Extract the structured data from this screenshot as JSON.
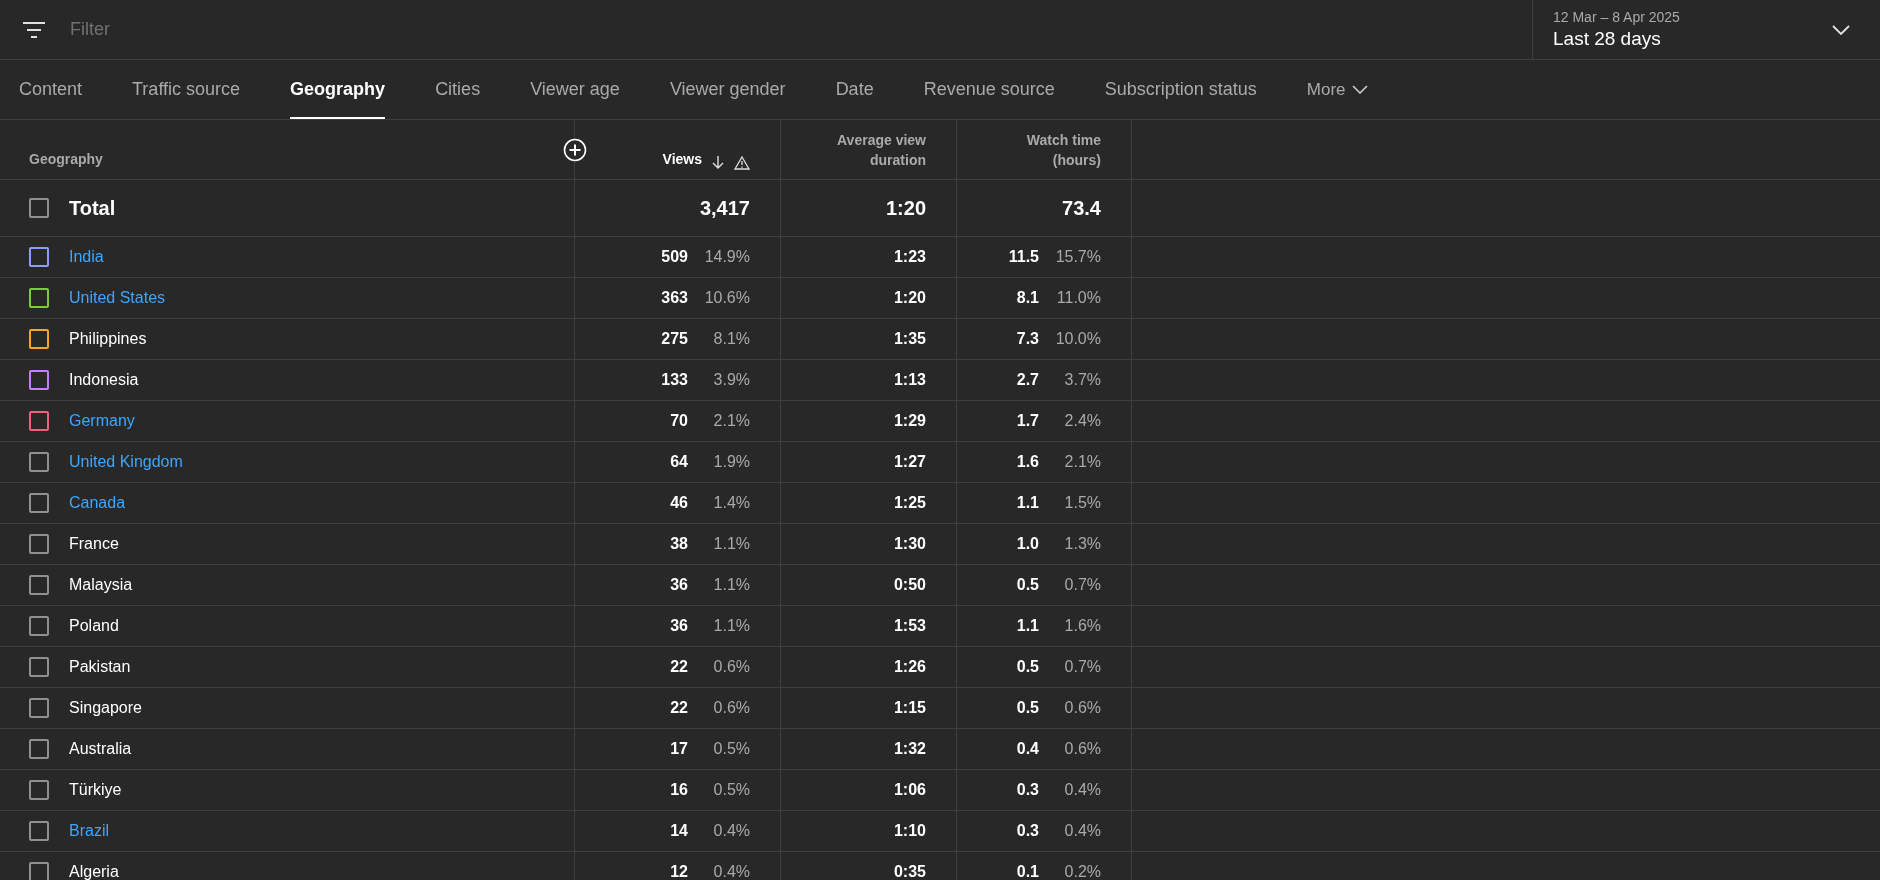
{
  "filter": {
    "placeholder": "Filter"
  },
  "date_range": {
    "range": "12 Mar – 8 Apr 2025",
    "label": "Last 28 days"
  },
  "tabs": [
    {
      "label": "Content",
      "selected": false
    },
    {
      "label": "Traffic source",
      "selected": false
    },
    {
      "label": "Geography",
      "selected": true
    },
    {
      "label": "Cities",
      "selected": false
    },
    {
      "label": "Viewer age",
      "selected": false
    },
    {
      "label": "Viewer gender",
      "selected": false
    },
    {
      "label": "Date",
      "selected": false
    },
    {
      "label": "Revenue source",
      "selected": false
    },
    {
      "label": "Subscription status",
      "selected": false
    }
  ],
  "more": {
    "label": "More"
  },
  "table": {
    "columns": [
      "Geography",
      "Views",
      "Average view duration",
      "Watch time (hours)"
    ],
    "total": {
      "label": "Total",
      "checked": false,
      "views": "3,417",
      "avg": "1:20",
      "watch": "73.4"
    },
    "rows": [
      {
        "name": "India",
        "link": true,
        "checked": false,
        "color": "#8d9cff",
        "views": "509",
        "views_pct": "14.9%",
        "avg": "1:23",
        "watch": "11.5",
        "watch_pct": "15.7%"
      },
      {
        "name": "United States",
        "link": true,
        "checked": false,
        "color": "#7ccb3a",
        "views": "363",
        "views_pct": "10.6%",
        "avg": "1:20",
        "watch": "8.1",
        "watch_pct": "11.0%"
      },
      {
        "name": "Philippines",
        "link": false,
        "checked": false,
        "color": "#f5a623",
        "views": "275",
        "views_pct": "8.1%",
        "avg": "1:35",
        "watch": "7.3",
        "watch_pct": "10.0%"
      },
      {
        "name": "Indonesia",
        "link": false,
        "checked": false,
        "color": "#c77dff",
        "views": "133",
        "views_pct": "3.9%",
        "avg": "1:13",
        "watch": "2.7",
        "watch_pct": "3.7%"
      },
      {
        "name": "Germany",
        "link": true,
        "checked": false,
        "color": "#f0607a",
        "views": "70",
        "views_pct": "2.1%",
        "avg": "1:29",
        "watch": "1.7",
        "watch_pct": "2.4%"
      },
      {
        "name": "United Kingdom",
        "link": true,
        "checked": false,
        "views": "64",
        "views_pct": "1.9%",
        "avg": "1:27",
        "watch": "1.6",
        "watch_pct": "2.1%"
      },
      {
        "name": "Canada",
        "link": true,
        "checked": false,
        "views": "46",
        "views_pct": "1.4%",
        "avg": "1:25",
        "watch": "1.1",
        "watch_pct": "1.5%"
      },
      {
        "name": "France",
        "link": false,
        "checked": false,
        "views": "38",
        "views_pct": "1.1%",
        "avg": "1:30",
        "watch": "1.0",
        "watch_pct": "1.3%"
      },
      {
        "name": "Malaysia",
        "link": false,
        "checked": false,
        "views": "36",
        "views_pct": "1.1%",
        "avg": "0:50",
        "watch": "0.5",
        "watch_pct": "0.7%"
      },
      {
        "name": "Poland",
        "link": false,
        "checked": false,
        "views": "36",
        "views_pct": "1.1%",
        "avg": "1:53",
        "watch": "1.1",
        "watch_pct": "1.6%"
      },
      {
        "name": "Pakistan",
        "link": false,
        "checked": false,
        "views": "22",
        "views_pct": "0.6%",
        "avg": "1:26",
        "watch": "0.5",
        "watch_pct": "0.7%"
      },
      {
        "name": "Singapore",
        "link": false,
        "checked": false,
        "views": "22",
        "views_pct": "0.6%",
        "avg": "1:15",
        "watch": "0.5",
        "watch_pct": "0.6%"
      },
      {
        "name": "Australia",
        "link": false,
        "checked": false,
        "views": "17",
        "views_pct": "0.5%",
        "avg": "1:32",
        "watch": "0.4",
        "watch_pct": "0.6%"
      },
      {
        "name": "Türkiye",
        "link": false,
        "checked": false,
        "views": "16",
        "views_pct": "0.5%",
        "avg": "1:06",
        "watch": "0.3",
        "watch_pct": "0.4%"
      },
      {
        "name": "Brazil",
        "link": true,
        "checked": false,
        "views": "14",
        "views_pct": "0.4%",
        "avg": "1:10",
        "watch": "0.3",
        "watch_pct": "0.4%"
      },
      {
        "name": "Algeria",
        "link": false,
        "checked": false,
        "views": "12",
        "views_pct": "0.4%",
        "avg": "0:35",
        "watch": "0.1",
        "watch_pct": "0.2%"
      }
    ]
  }
}
